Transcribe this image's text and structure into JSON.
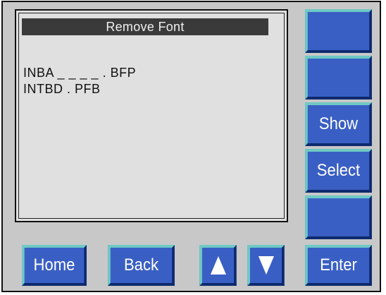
{
  "screen": {
    "title": "Remove Font",
    "files": [
      "INBA _ _ _ _ . BFP",
      "INTBD . PFB"
    ]
  },
  "side_buttons": [
    {
      "label": ""
    },
    {
      "label": ""
    },
    {
      "label": "Show"
    },
    {
      "label": "Select"
    },
    {
      "label": ""
    }
  ],
  "bottom_buttons": {
    "home": "Home",
    "back": "Back",
    "up_icon": "arrow-up-icon",
    "down_icon": "arrow-down-icon",
    "enter": "Enter"
  },
  "colors": {
    "button_face": "#3a5fc4",
    "button_highlight": "#6ec9c4",
    "button_shadow": "#0e2a6e",
    "screen_bg": "#e0e0e0",
    "title_bar": "#3a3a3a",
    "bezel": "#c8c8c8"
  }
}
